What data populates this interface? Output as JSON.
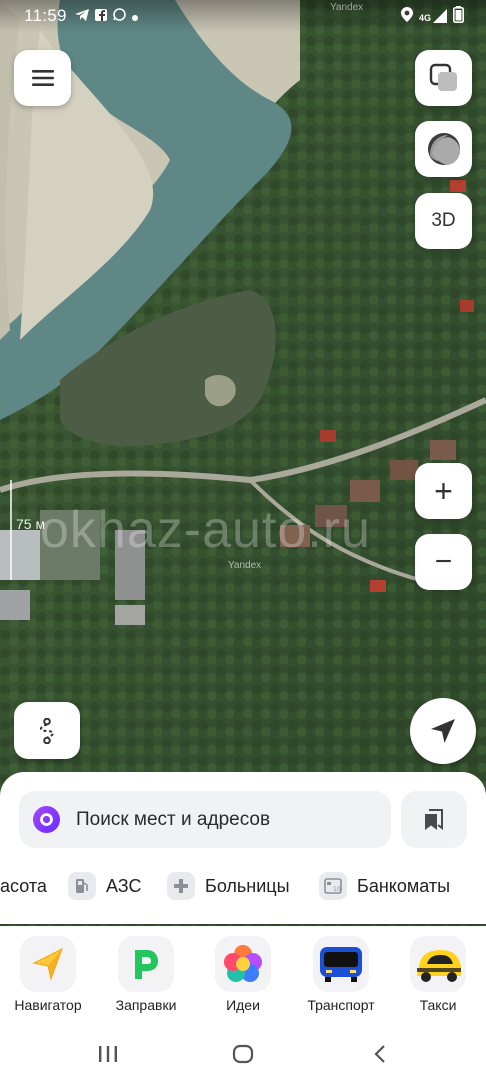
{
  "status_bar": {
    "time": "11:59",
    "left_icons": [
      "telegram-icon",
      "facebook-icon",
      "whatsapp-icon",
      "dot-icon"
    ],
    "right_icons": [
      "location-icon",
      "signal-4g-icon",
      "battery-icon"
    ],
    "network": "4G",
    "overlay_text": "Yandex"
  },
  "map": {
    "scale_label": "75 м",
    "watermark": "okhaz-auto.ru",
    "copyright": "Yandex",
    "controls": {
      "menu": "menu-icon",
      "layers": "layers-icon",
      "night": "night-mode-icon",
      "three_d": "3D",
      "zoom_in": "+",
      "zoom_out": "−",
      "route": "route-icon",
      "location": "locate-arrow-icon"
    }
  },
  "sheet": {
    "search_placeholder": "Поиск мест и адресов",
    "categories": [
      {
        "label": "асота",
        "icon": ""
      },
      {
        "label": "АЗС",
        "icon": "fuel-icon"
      },
      {
        "label": "Больницы",
        "icon": "hospital-icon"
      },
      {
        "label": "Банкоматы",
        "icon": "atm-icon"
      }
    ]
  },
  "apps": [
    {
      "label": "Навигатор",
      "icon": "navigator-icon"
    },
    {
      "label": "Заправки",
      "icon": "fuel-app-icon"
    },
    {
      "label": "Идеи",
      "icon": "ideas-icon"
    },
    {
      "label": "Транспорт",
      "icon": "bus-icon"
    },
    {
      "label": "Такси",
      "icon": "taxi-icon"
    }
  ],
  "colors": {
    "accent": "#8a3cff",
    "taxi": "#ffd21e",
    "fuel_green": "#22c55e",
    "bus_blue": "#1a4fd6"
  }
}
